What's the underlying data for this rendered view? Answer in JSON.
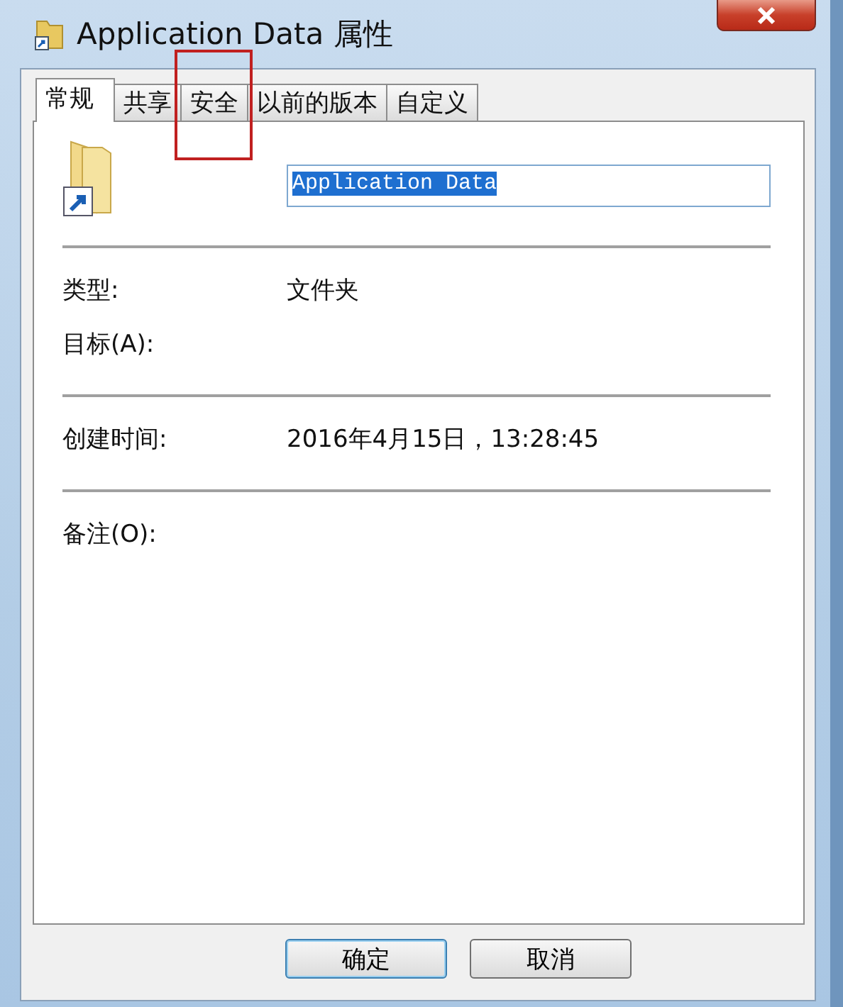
{
  "window": {
    "title": "Application Data 属性"
  },
  "tabs": [
    {
      "label": "常规",
      "selected": true,
      "highlighted": false
    },
    {
      "label": "共享",
      "selected": false,
      "highlighted": false
    },
    {
      "label": "安全",
      "selected": false,
      "highlighted": true
    },
    {
      "label": "以前的版本",
      "selected": false,
      "highlighted": false
    },
    {
      "label": "自定义",
      "selected": false,
      "highlighted": false
    }
  ],
  "name_field": {
    "value": "Application Data",
    "selected": true
  },
  "sections": [
    [
      {
        "label": "类型:",
        "value": "文件夹"
      },
      {
        "label": "目标(A):"
      }
    ],
    [
      {
        "label": "创建时间:",
        "value": "2016年4月15日，13:28:45"
      }
    ],
    [
      {
        "label": "备注(O):"
      }
    ]
  ],
  "buttons": [
    {
      "label": "确定",
      "default": true
    },
    {
      "label": "取消",
      "default": false
    }
  ]
}
